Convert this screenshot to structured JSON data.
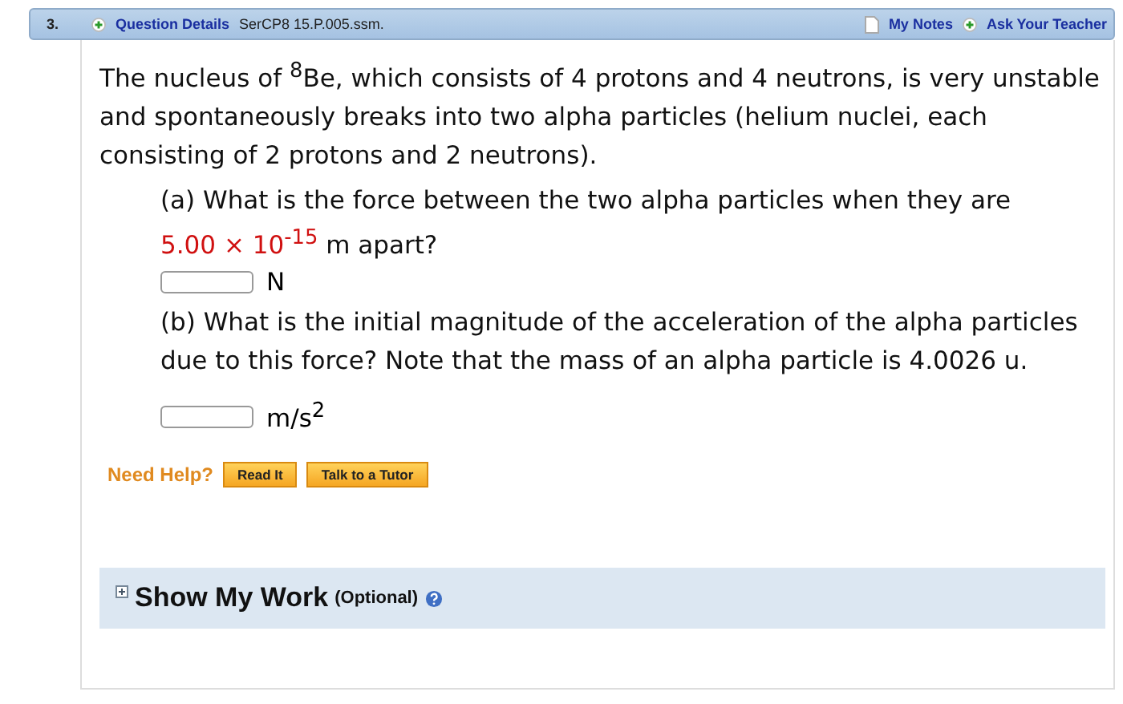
{
  "header": {
    "number": "3.",
    "details_link": "Question Details",
    "source": "SerCP8 15.P.005.ssm.",
    "notes_link": "My Notes",
    "ask_link": "Ask Your Teacher"
  },
  "intro": "The nucleus of $^{8}$Be, which consists of 4 protons and 4 neutrons, is very unstable and spontaneously breaks into two alpha particles (helium nuclei, each consisting of 2 protons and 2 neutrons).",
  "parts": [
    {
      "prompt": "(a) What is the force between the two alpha particles when they are",
      "given": "5.00 × 10$^{-15}$",
      "prompt_end": "m apart?",
      "unit": "N"
    },
    {
      "prompt": "(b) What is the initial magnitude of the acceleration of the alpha particles due to this force? Note that the mass of an alpha particle is 4.0026 u.",
      "unit": "m/s$^{2}$"
    }
  ],
  "help": {
    "label": "Need Help?",
    "buttons": [
      "Read It",
      "Talk to a Tutor"
    ]
  },
  "show_work": {
    "title": "Show My Work",
    "note": "(Optional)",
    "expanded": false
  }
}
